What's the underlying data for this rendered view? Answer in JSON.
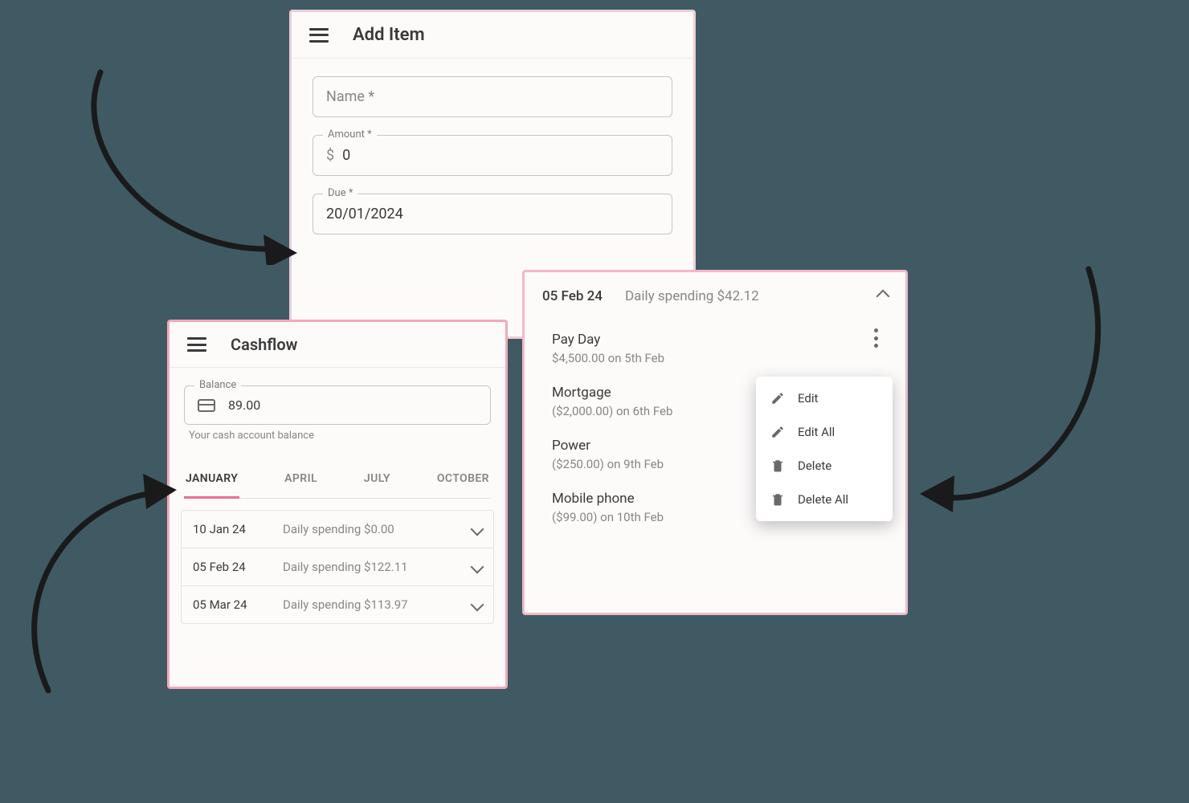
{
  "addItem": {
    "title": "Add Item",
    "name_label": "Name *",
    "amount_label": "Amount *",
    "amount_currency": "$",
    "amount_value": "0",
    "due_label": "Due *",
    "due_value": "20/01/2024"
  },
  "cashflow": {
    "title": "Cashflow",
    "balance_label": "Balance",
    "balance_value": "89.00",
    "balance_helper": "Your cash account balance",
    "tabs": [
      "JANUARY",
      "APRIL",
      "JULY",
      "OCTOBER"
    ],
    "rows": [
      {
        "date": "10 Jan 24",
        "spend": "Daily spending $0.00"
      },
      {
        "date": "05 Feb 24",
        "spend": "Daily spending $122.11"
      },
      {
        "date": "05 Mar 24",
        "spend": "Daily spending $113.97"
      }
    ]
  },
  "detail": {
    "date": "05 Feb 24",
    "spend": "Daily spending $42.12",
    "items": [
      {
        "name": "Pay Day",
        "sub": "$4,500.00 on 5th Feb"
      },
      {
        "name": "Mortgage",
        "sub": "($2,000.00) on 6th Feb"
      },
      {
        "name": "Power",
        "sub": "($250.00) on 9th Feb"
      },
      {
        "name": "Mobile phone",
        "sub": "($99.00) on 10th Feb"
      }
    ],
    "menu": {
      "edit": "Edit",
      "edit_all": "Edit All",
      "delete": "Delete",
      "delete_all": "Delete All"
    }
  }
}
